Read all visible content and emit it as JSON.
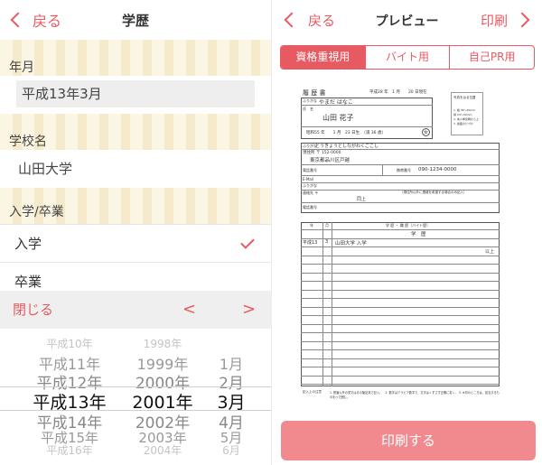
{
  "left": {
    "nav": {
      "back": "戻る",
      "title": "学歴"
    },
    "year_month": {
      "label": "年月",
      "value": "平成13年3月"
    },
    "school": {
      "label": "学校名",
      "value": "山田大学"
    },
    "status": {
      "label": "入学/卒業",
      "options": [
        "入学",
        "卒業"
      ],
      "selected": "入学"
    },
    "toolbar": {
      "close": "閉じる",
      "prev": "<",
      "next": ">"
    },
    "picker": {
      "rows": [
        [
          "平成10年",
          "1998年",
          ""
        ],
        [
          "平成11年",
          "1999年",
          "1月"
        ],
        [
          "平成12年",
          "2000年",
          "2月"
        ],
        [
          "平成13年",
          "2001年",
          "3月"
        ],
        [
          "平成14年",
          "2002年",
          "4月"
        ],
        [
          "平成15年",
          "2003年",
          "5月"
        ],
        [
          "平成16年",
          "2004年",
          "6月"
        ]
      ]
    }
  },
  "right": {
    "nav": {
      "back": "戻る",
      "title": "プレビュー",
      "print": "印刷"
    },
    "tabs": [
      {
        "label": "資格重視用",
        "active": true
      },
      {
        "label": "バイト用",
        "active": false
      },
      {
        "label": "自己PR用",
        "active": false
      }
    ],
    "document": {
      "heading": "履 歴 書",
      "date": "平成28 年　1 月　　20 日現在",
      "furigana_label": "ふりがな",
      "furigana": "やまだ はなこ",
      "name_label": "氏　名",
      "name": "山田 花子",
      "birth": "昭和55 年　　1 月　23 日生　（満 36 歳）",
      "sex": "女",
      "photo_caption": "写真をはる位置",
      "photo_notes": [
        "1. 縦 36～40mm",
        "横 24～30mm",
        "2. 本人単身胸から上",
        "3. 裏面のりづけ"
      ],
      "address_furigana": "とうきょうとしながわくごこし",
      "postal": "現住所 〒 152-0000",
      "address": "東京都品川区戸越",
      "phone_label": "電話番号",
      "mobile_label": "携帯番号",
      "mobile": "090-1234-0000",
      "email_label": "E-Mail",
      "contact_label": "連絡先 〒",
      "contact_note": "（現住所以外に連絡を希望する場合のみ記入）",
      "contact_same": "同上",
      "history_heading": "学 歴 ・ 職 歴（バイト歴）",
      "col_year": "年",
      "col_month": "月",
      "section": "学　歴",
      "entry_year": "平成13",
      "entry_month": "3",
      "entry_text": "山田大学 入学",
      "end_text": "以上",
      "note_label": "記入上の注意",
      "notes": "1. 鉛筆以外の黒又は青の筆記具で記入。　2. 数字はアラビア数字で、文字はくずさず正確に書く。 3. ※印のところは、該当するものを○で囲む。"
    },
    "print_button": "印刷する"
  },
  "colors": {
    "accent": "#e85a62",
    "button": "#f08a8f",
    "stripe": "#fbf5e3"
  }
}
